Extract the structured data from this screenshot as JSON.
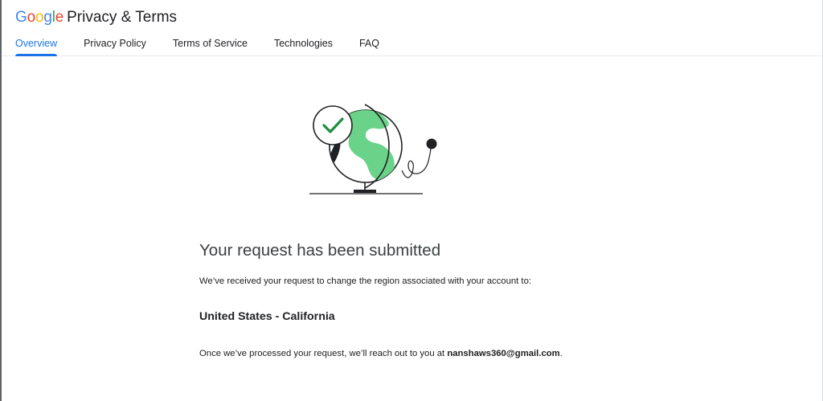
{
  "header": {
    "logo": [
      "G",
      "o",
      "o",
      "g",
      "l",
      "e"
    ],
    "logo_colors": [
      "#4285F4",
      "#EA4335",
      "#FBBC05",
      "#4285F4",
      "#34A853",
      "#EA4335"
    ],
    "title": "Privacy & Terms",
    "tabs": [
      {
        "label": "Overview",
        "active": true
      },
      {
        "label": "Privacy Policy",
        "active": false
      },
      {
        "label": "Terms of Service",
        "active": false
      },
      {
        "label": "Technologies",
        "active": false
      },
      {
        "label": "FAQ",
        "active": false
      }
    ]
  },
  "illustration": {
    "icon": "globe-with-check-icon",
    "colors": {
      "land": "#6ad389",
      "check": "#1e8e3e",
      "stroke": "#202124"
    }
  },
  "main": {
    "headline": "Your request has been submitted",
    "description": "We’ve received your request to change the region associated with your account to:",
    "region": "United States - California",
    "followup_prefix": "Once we’ve processed your request, we’ll reach out to you at ",
    "email": "nanshaws360@gmail.com",
    "followup_suffix": "."
  },
  "accent_color": "#1a73e8"
}
